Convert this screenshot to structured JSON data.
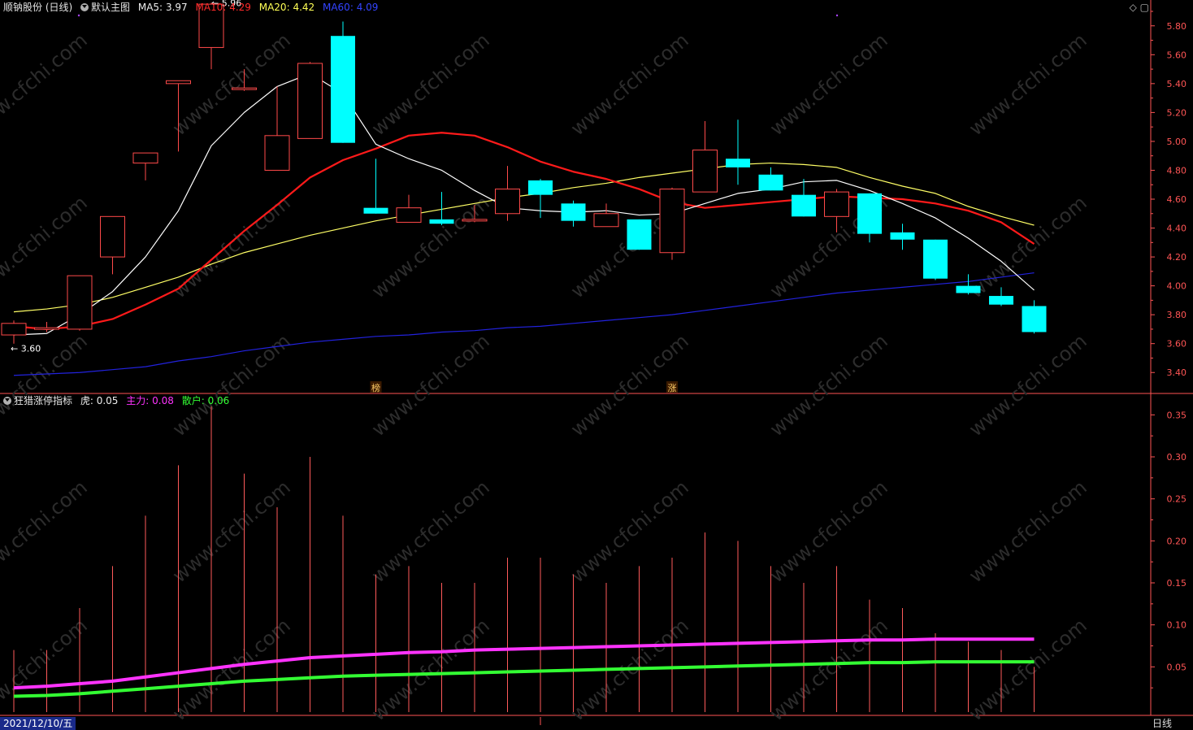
{
  "main_header": {
    "stock": "顺钠股份 (日线)",
    "chart_name": "默认主图",
    "ma5_label": "MA5:",
    "ma5_value": "3.97",
    "ma10_label": "MA10:",
    "ma10_value": "4.29",
    "ma20_label": "MA20:",
    "ma20_value": "4.42",
    "ma60_label": "MA60:",
    "ma60_value": "4.09"
  },
  "ind_header": {
    "name": "狂猎涨停指标",
    "tiger_label": "虎:",
    "tiger_value": "0.05",
    "main_label": "主力:",
    "main_value": "0.08",
    "retail_label": "散户:",
    "retail_value": "0.06"
  },
  "footer": {
    "date": "2021/12/10/五",
    "period": "日线"
  },
  "watermark": "www.cfchi.com",
  "colors": {
    "up": "#ff4a4a",
    "down": "#00ffff",
    "ma5": "#ffffff",
    "ma10": "#ff1a1a",
    "ma20": "#ffff66",
    "ma60": "#2222dd",
    "zhuli": "#ff33ff",
    "sanhu": "#33ff33",
    "grid": "#7a0000",
    "axis": "#ff5555"
  },
  "chart_data": [
    {
      "type": "candlestick",
      "ylim": [
        3.3,
        5.9
      ],
      "yticks": [
        "5.80",
        "5.60",
        "5.40",
        "5.20",
        "5.00",
        "4.80",
        "4.60",
        "4.40",
        "4.20",
        "4.00",
        "3.80",
        "3.60",
        "3.40"
      ],
      "candles": [
        {
          "o": 3.66,
          "h": 3.76,
          "l": 3.6,
          "c": 3.74
        },
        {
          "o": 3.7,
          "h": 3.75,
          "l": 3.68,
          "c": 3.71
        },
        {
          "o": 3.7,
          "h": 4.07,
          "l": 3.69,
          "c": 4.07
        },
        {
          "o": 4.2,
          "h": 4.48,
          "l": 4.08,
          "c": 4.48
        },
        {
          "o": 4.85,
          "h": 4.92,
          "l": 4.73,
          "c": 4.92
        },
        {
          "o": 5.4,
          "h": 5.42,
          "l": 4.93,
          "c": 5.42
        },
        {
          "o": 5.65,
          "h": 5.96,
          "l": 5.5,
          "c": 5.95
        },
        {
          "o": 5.37,
          "h": 5.5,
          "l": 5.35,
          "c": 5.37
        },
        {
          "o": 4.8,
          "h": 5.38,
          "l": 4.8,
          "c": 5.04
        },
        {
          "o": 5.02,
          "h": 5.55,
          "l": 5.02,
          "c": 5.54
        },
        {
          "o": 5.73,
          "h": 5.83,
          "l": 4.99,
          "c": 4.99
        },
        {
          "o": 4.54,
          "h": 4.88,
          "l": 4.5,
          "c": 4.5
        },
        {
          "o": 4.44,
          "h": 4.63,
          "l": 4.44,
          "c": 4.54
        },
        {
          "o": 4.46,
          "h": 4.65,
          "l": 4.42,
          "c": 4.43
        },
        {
          "o": 4.45,
          "h": 4.56,
          "l": 4.44,
          "c": 4.46
        },
        {
          "o": 4.5,
          "h": 4.83,
          "l": 4.45,
          "c": 4.67
        },
        {
          "o": 4.73,
          "h": 4.74,
          "l": 4.47,
          "c": 4.63
        },
        {
          "o": 4.57,
          "h": 4.59,
          "l": 4.41,
          "c": 4.45
        },
        {
          "o": 4.41,
          "h": 4.57,
          "l": 4.41,
          "c": 4.5
        },
        {
          "o": 4.46,
          "h": 4.46,
          "l": 4.25,
          "c": 4.25
        },
        {
          "o": 4.23,
          "h": 4.68,
          "l": 4.18,
          "c": 4.67
        },
        {
          "o": 4.65,
          "h": 5.14,
          "l": 4.65,
          "c": 4.94
        },
        {
          "o": 4.88,
          "h": 5.15,
          "l": 4.7,
          "c": 4.82
        },
        {
          "o": 4.77,
          "h": 4.82,
          "l": 4.66,
          "c": 4.66
        },
        {
          "o": 4.63,
          "h": 4.74,
          "l": 4.48,
          "c": 4.48
        },
        {
          "o": 4.48,
          "h": 4.67,
          "l": 4.37,
          "c": 4.65
        },
        {
          "o": 4.64,
          "h": 4.64,
          "l": 4.3,
          "c": 4.36
        },
        {
          "o": 4.37,
          "h": 4.43,
          "l": 4.25,
          "c": 4.32
        },
        {
          "o": 4.32,
          "h": 4.32,
          "l": 4.04,
          "c": 4.05
        },
        {
          "o": 4.0,
          "h": 4.08,
          "l": 3.94,
          "c": 3.95
        },
        {
          "o": 3.93,
          "h": 3.99,
          "l": 3.86,
          "c": 3.87
        },
        {
          "o": 3.86,
          "h": 3.9,
          "l": 3.67,
          "c": 3.68
        }
      ],
      "ma5": [
        3.66,
        3.67,
        3.8,
        3.96,
        4.2,
        4.52,
        4.97,
        5.2,
        5.38,
        5.47,
        5.33,
        4.98,
        4.88,
        4.8,
        4.66,
        4.54,
        4.52,
        4.51,
        4.52,
        4.49,
        4.5,
        4.57,
        4.64,
        4.67,
        4.72,
        4.73,
        4.66,
        4.57,
        4.47,
        4.33,
        4.17,
        3.97
      ],
      "ma10": [
        3.72,
        3.7,
        3.72,
        3.77,
        3.87,
        3.98,
        4.18,
        4.38,
        4.56,
        4.75,
        4.87,
        4.95,
        5.04,
        5.06,
        5.04,
        4.96,
        4.86,
        4.79,
        4.74,
        4.67,
        4.58,
        4.54,
        4.56,
        4.58,
        4.6,
        4.62,
        4.61,
        4.6,
        4.57,
        4.52,
        4.44,
        4.29
      ],
      "ma20": [
        3.82,
        3.84,
        3.87,
        3.92,
        3.99,
        4.06,
        4.15,
        4.23,
        4.29,
        4.35,
        4.4,
        4.45,
        4.49,
        4.53,
        4.57,
        4.61,
        4.64,
        4.68,
        4.71,
        4.75,
        4.78,
        4.81,
        4.84,
        4.85,
        4.84,
        4.82,
        4.75,
        4.69,
        4.64,
        4.55,
        4.48,
        4.42
      ],
      "ma60": [
        3.38,
        3.39,
        3.4,
        3.42,
        3.44,
        3.48,
        3.51,
        3.55,
        3.58,
        3.61,
        3.63,
        3.65,
        3.66,
        3.68,
        3.69,
        3.71,
        3.72,
        3.74,
        3.76,
        3.78,
        3.8,
        3.83,
        3.86,
        3.89,
        3.92,
        3.95,
        3.97,
        3.99,
        4.01,
        4.03,
        4.06,
        4.09
      ],
      "annotations": [
        {
          "index": 6,
          "label": "5.96"
        },
        {
          "index": 0,
          "label": "3.60"
        }
      ],
      "markers": [
        {
          "index": 11,
          "label": "榜"
        },
        {
          "index": 20,
          "label": "涨"
        }
      ]
    },
    {
      "type": "bar+line",
      "ylim": [
        0.0,
        0.36
      ],
      "yticks": [
        "0.35",
        "0.30",
        "0.25",
        "0.20",
        "0.15",
        "0.10",
        "0.05"
      ],
      "tiger": [
        0.07,
        0.07,
        0.12,
        0.17,
        0.23,
        0.29,
        0.36,
        0.28,
        0.24,
        0.3,
        0.23,
        0.16,
        0.17,
        0.15,
        0.15,
        0.18,
        0.18,
        0.16,
        0.15,
        0.17,
        0.18,
        0.21,
        0.2,
        0.17,
        0.15,
        0.17,
        0.13,
        0.12,
        0.09,
        0.08,
        0.07,
        0.05
      ],
      "zhuli": [
        0.025,
        0.027,
        0.03,
        0.033,
        0.038,
        0.043,
        0.048,
        0.053,
        0.057,
        0.061,
        0.063,
        0.065,
        0.067,
        0.068,
        0.07,
        0.071,
        0.072,
        0.073,
        0.074,
        0.075,
        0.076,
        0.077,
        0.078,
        0.079,
        0.08,
        0.081,
        0.082,
        0.082,
        0.083,
        0.083,
        0.083,
        0.083
      ],
      "sanhu": [
        0.015,
        0.016,
        0.018,
        0.021,
        0.024,
        0.027,
        0.03,
        0.033,
        0.035,
        0.037,
        0.039,
        0.04,
        0.041,
        0.042,
        0.043,
        0.044,
        0.045,
        0.046,
        0.047,
        0.048,
        0.049,
        0.05,
        0.051,
        0.052,
        0.053,
        0.054,
        0.055,
        0.055,
        0.056,
        0.056,
        0.056,
        0.056
      ]
    }
  ]
}
